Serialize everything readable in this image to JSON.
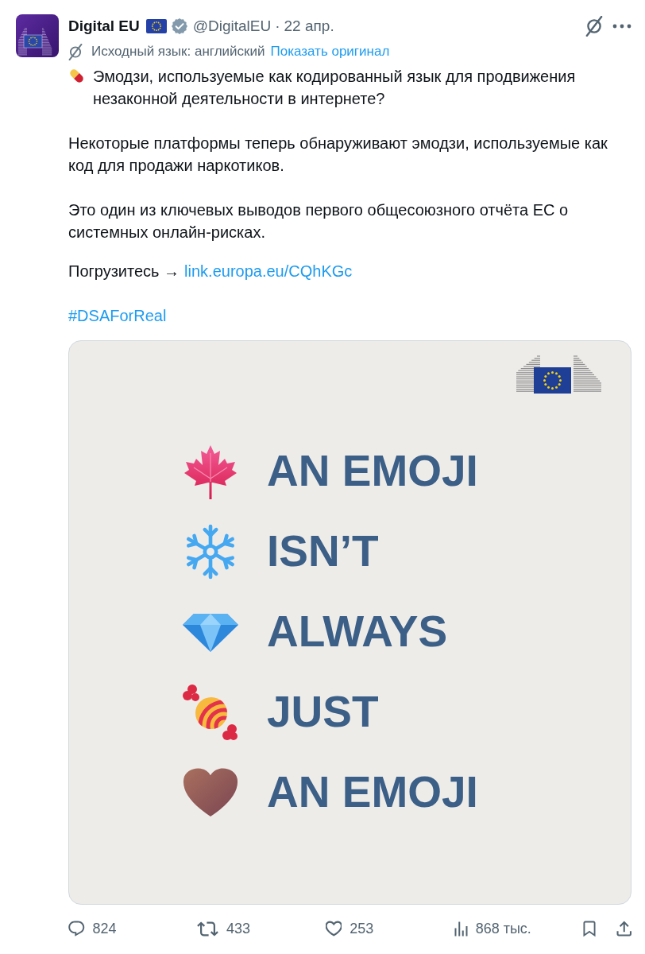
{
  "post": {
    "author": {
      "name": "Digital EU",
      "verified": true,
      "handle": "@DigitalEU",
      "separator": "·",
      "date": "22 апр."
    },
    "translation": {
      "note": "Исходный язык: английский",
      "action": "Показать оригинал"
    },
    "paragraphs": [
      {
        "kind": "pill",
        "text": "Эмодзи, используемые как кодированный язык для продвижения незаконной деятельности в интернете?"
      },
      {
        "kind": "plain",
        "text": "Некоторые платформы теперь обнаруживают эмодзи, используемые как код для продажи наркотиков."
      },
      {
        "kind": "plain",
        "text": "Это один из ключевых выводов первого общесоюзного отчёта ЕС о системных онлайн-рисках."
      },
      {
        "kind": "link",
        "text": "Погрузитесь →",
        "link": "link.europa.eu/CQhKGc"
      },
      {
        "kind": "hashtag",
        "text": "#DSAForReal"
      }
    ],
    "image": {
      "lines": [
        {
          "kind": "leaf",
          "text": "AN EMOJI"
        },
        {
          "kind": "snowflake",
          "text": "ISN’T"
        },
        {
          "kind": "diamond",
          "text": "ALWAYS"
        },
        {
          "kind": "candy",
          "text": "JUST"
        },
        {
          "kind": "heart",
          "text": "AN EMOJI"
        }
      ]
    },
    "actions": [
      {
        "kind": "reply",
        "count": "824"
      },
      {
        "kind": "repost",
        "count": "433"
      },
      {
        "kind": "like",
        "count": "253"
      },
      {
        "kind": "views",
        "count": "868 тыс."
      },
      {
        "kind": "bookmark"
      },
      {
        "kind": "share"
      }
    ]
  }
}
